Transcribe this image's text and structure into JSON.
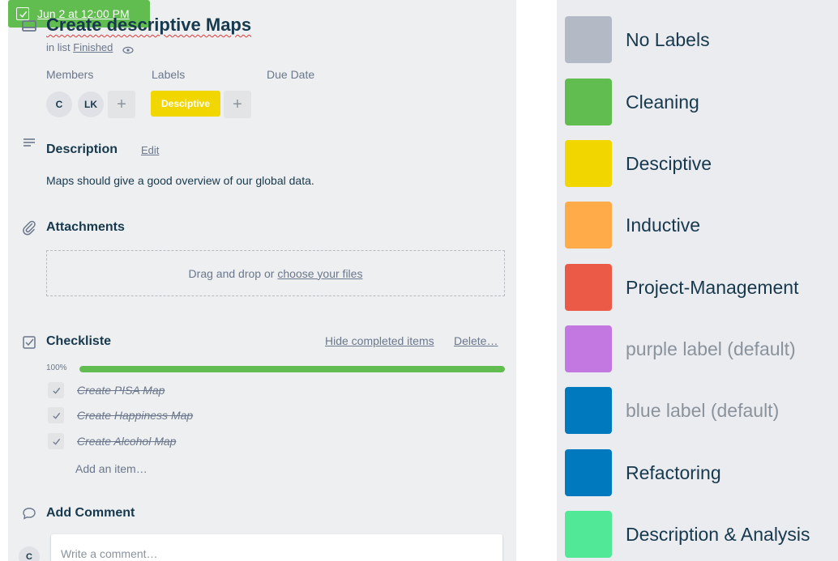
{
  "card": {
    "title": "Create descriptive Maps",
    "in_list_prefix": "in list",
    "list_name": "Finished",
    "members_label": "Members",
    "labels_label": "Labels",
    "due_date_label": "Due Date",
    "members": [
      "C",
      "LK"
    ],
    "add_symbol": "+",
    "label": {
      "name": "Desciptive",
      "color": "#f2d600"
    },
    "due_date": {
      "text": "Jun 2 at 12:00 PM",
      "color": "#61bd4f",
      "complete": true
    }
  },
  "description": {
    "title": "Description",
    "edit_label": "Edit",
    "text": "Maps should give a good overview of our global data."
  },
  "attachments": {
    "title": "Attachments",
    "drop_text": "Drag and drop or",
    "choose_link": "choose your files"
  },
  "checklist": {
    "title": "Checkliste",
    "hide_completed": "Hide completed items",
    "delete": "Delete…",
    "progress_label": "100%",
    "progress": 1.0,
    "items": [
      {
        "text": "Create PISA Map",
        "done": true
      },
      {
        "text": "Create Happiness Map",
        "done": true
      },
      {
        "text": "Create Alcohol Map",
        "done": true
      }
    ],
    "add_item": "Add an item…"
  },
  "comment": {
    "title": "Add Comment",
    "avatar": "C",
    "placeholder": "Write a comment…"
  },
  "label_list": [
    {
      "name": "No Labels",
      "color": "#b3bac5",
      "muted": false
    },
    {
      "name": "Cleaning",
      "color": "#61bd4f",
      "muted": false
    },
    {
      "name": "Desciptive",
      "color": "#f2d600",
      "muted": false
    },
    {
      "name": "Inductive",
      "color": "#ffab4a",
      "muted": false
    },
    {
      "name": "Project-Management",
      "color": "#eb5a46",
      "muted": false
    },
    {
      "name": "purple label (default)",
      "color": "#c377e0",
      "muted": true
    },
    {
      "name": "blue label (default)",
      "color": "#0079bf",
      "muted": true
    },
    {
      "name": "Refactoring",
      "color": "#0079bf",
      "muted": false
    },
    {
      "name": "Description & Analysis",
      "color": "#51e898",
      "muted": false
    }
  ],
  "icons": {
    "card": "card-icon",
    "watch": "eye-icon",
    "description": "description-icon",
    "attachment": "paperclip-icon",
    "checklist": "checklist-icon",
    "comment": "comment-icon",
    "check": "checkmark-icon"
  }
}
